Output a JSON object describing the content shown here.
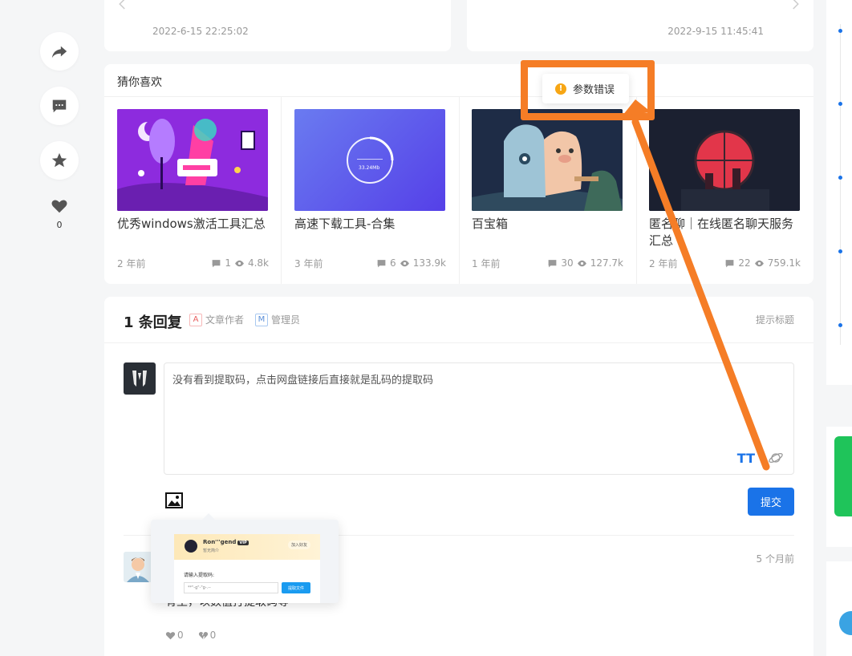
{
  "nav_cards": {
    "prev_date": "2022-6-15 22:25:02",
    "next_date": "2022-9-15 11:45:41"
  },
  "float_actions": {
    "like_count": "0"
  },
  "recommend": {
    "title": "猜你喜欢",
    "items": [
      {
        "title": "优秀windows激活工具汇总",
        "time": "2 年前",
        "comments": "1",
        "views": "4.8k"
      },
      {
        "title": "高速下载工具-合集",
        "time": "3 年前",
        "comments": "6",
        "views": "133.9k",
        "thumb_text": "33.24Mb"
      },
      {
        "title": "百宝箱",
        "time": "1 年前",
        "comments": "30",
        "views": "127.7k"
      },
      {
        "title": "匿名聊｜在线匿名聊天服务汇总",
        "time": "2 年前",
        "comments": "22",
        "views": "759.1k"
      }
    ]
  },
  "comments": {
    "heading": "1 条回复",
    "legend_author_mark": "A",
    "legend_author": "文章作者",
    "legend_admin_mark": "M",
    "legend_admin": "管理员",
    "hint_link": "提示标题",
    "editor_text": "没有看到提取码，点击网盘链接后直接就是乱码的提取码",
    "editor_tt": "TT",
    "submit_label": "提交",
    "item": {
      "time": "5 个月前",
      "text": "有主，以数值打提取码等",
      "likes": "0",
      "dislikes": "0"
    }
  },
  "popup_preview": {
    "name": "Ron'''gend",
    "vip": "VIP",
    "sub": "暂无简介",
    "follow": "加入好友",
    "label": "请输入提取码:",
    "input": "**\"-g\"-\"g-.--",
    "button": "提取文件"
  },
  "toast": {
    "text": "参数错误",
    "icon": "!"
  },
  "colors": {
    "accent": "#1a73e8",
    "annotation": "#f57d26",
    "warning": "#f7a614"
  }
}
